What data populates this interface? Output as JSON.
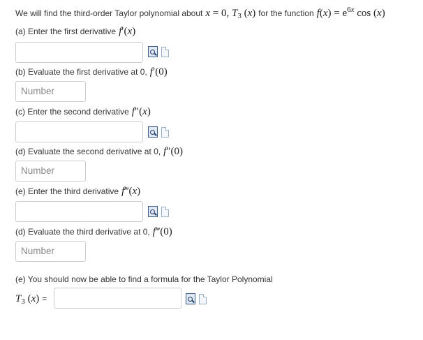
{
  "intro": {
    "text_before": "We will find the third-order Taylor polynomial about",
    "about_math": "x = 0, T₃(x)",
    "text_mid": "for the function",
    "function_math": "f(x) = e^(6x) cos(x)"
  },
  "q_a": {
    "label": "(a) Enter the first derivative",
    "math": "f′(x)"
  },
  "q_b": {
    "label": "(b) Evaluate the first derivative at 0,",
    "math": "f′(0)",
    "placeholder": "Number"
  },
  "q_c": {
    "label": "(c) Enter the second derivative",
    "math": "f″(x)"
  },
  "q_d1": {
    "label": "(d) Evaluate the second derivative at 0,",
    "math": "f″(0)",
    "placeholder": "Number"
  },
  "q_e1": {
    "label": "(e) Enter the third derivative",
    "math": "f‴(x)"
  },
  "q_d2": {
    "label": "(d) Evaluate the third derivative at 0,",
    "math": "f‴(0)",
    "placeholder": "Number"
  },
  "q_e2": {
    "label": "(e) You should now be able to find a formula for the Taylor Polynomial",
    "lhs": "T₃(x)",
    "equals": "="
  },
  "icons": {
    "preview": "preview-magnifier-icon",
    "help": "help-document-icon"
  }
}
